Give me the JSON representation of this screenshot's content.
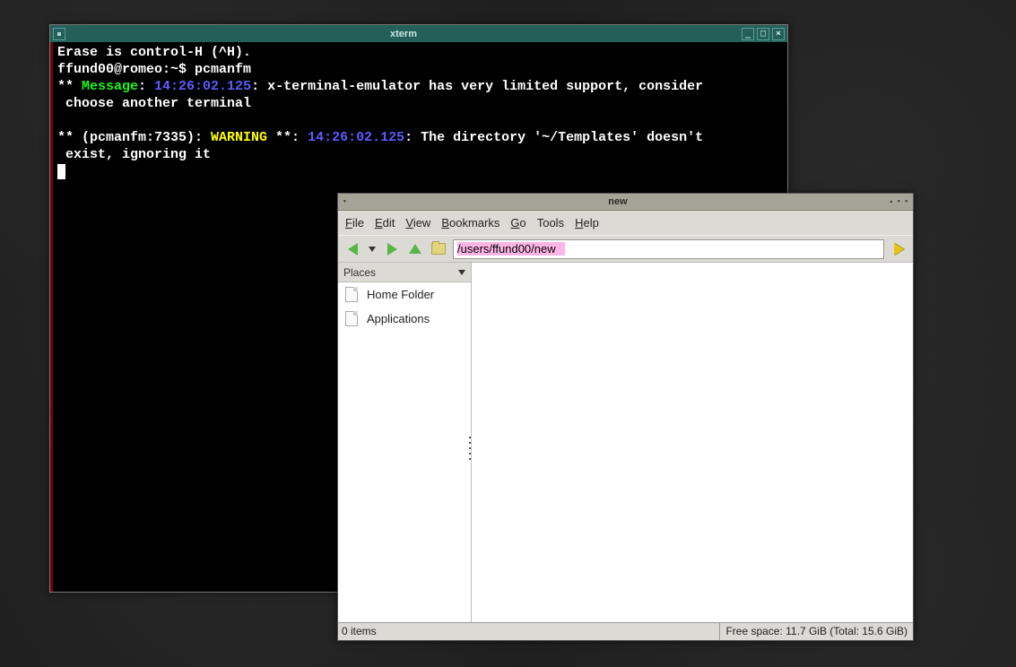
{
  "xterm": {
    "title": "xterm",
    "lines": {
      "erase": "Erase is control-H (^H).",
      "prompt_user": "ffund00@romeo:~$ ",
      "prompt_cmd": "pcmanfm",
      "msg_prefix": "** ",
      "msg_label": "Message",
      "msg_colon1": ": ",
      "msg_time1": "14:26:02.125",
      "msg_rest1": ": x-terminal-emulator has very limited support, consider",
      "msg_line2": " choose another terminal",
      "warn_prefix": "** (pcmanfm:7335): ",
      "warn_label": "WARNING",
      "warn_after": " **: ",
      "warn_time": "14:26:02.125",
      "warn_rest": ": The directory '~/Templates' doesn't",
      "warn_line2": " exist, ignoring it"
    }
  },
  "fm": {
    "title": "new",
    "menu": {
      "file": "File",
      "edit": "Edit",
      "view": "View",
      "bookmarks": "Bookmarks",
      "go": "Go",
      "tools": "Tools",
      "help": "Help"
    },
    "path": "/users/ffund00/new",
    "sidebar": {
      "header": "Places",
      "items": [
        "Home Folder",
        "Applications"
      ]
    },
    "status": {
      "items": "0 items",
      "space": "Free space: 11.7 GiB (Total: 15.6 GiB)"
    }
  }
}
